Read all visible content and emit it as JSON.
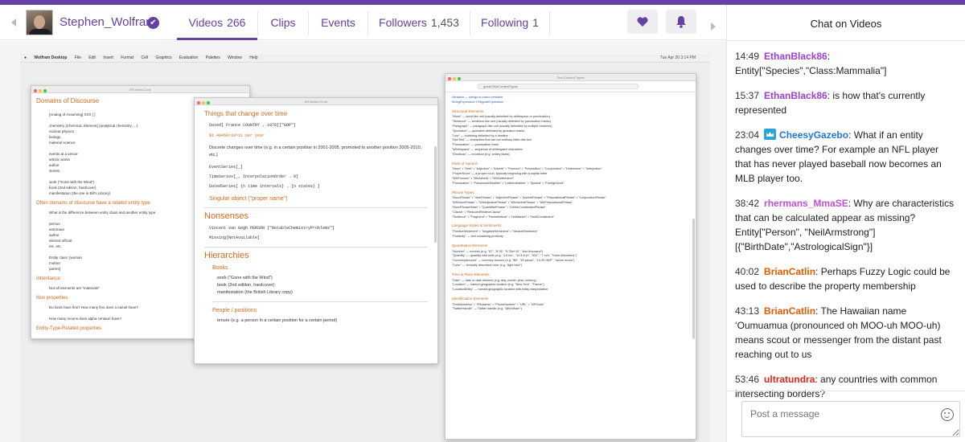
{
  "colors": {
    "brand": "#6441a4",
    "chat_user_purple": "#9b3fd6",
    "chat_user_orange": "#e05a00",
    "chat_user_red": "#e0251b",
    "chat_user_blue": "#2277d6"
  },
  "channel": {
    "name": "Stephen_Wolfram",
    "verified_icon": "check-circle-icon",
    "avatar_icon": "avatar"
  },
  "tabs": [
    {
      "label": "Videos",
      "count": "266",
      "active": true
    },
    {
      "label": "Clips",
      "count": ""
    },
    {
      "label": "Events",
      "count": ""
    },
    {
      "label": "Followers",
      "count": "1,453"
    },
    {
      "label": "Following",
      "count": "1"
    }
  ],
  "actions": {
    "follow_icon": "heart-icon",
    "notify_icon": "bell-icon"
  },
  "chat": {
    "title": "Chat on Videos",
    "input_placeholder": "Post a message",
    "messages": [
      {
        "time": "14:49",
        "user": "EthanBlack86",
        "color": "#9b3fd6",
        "text": "Entity[\"Species\",\"Class:Mammalia\"]",
        "badge": false
      },
      {
        "time": "15:37",
        "user": "EthanBlack86",
        "color": "#9b3fd6",
        "text": "is how that's currently represented",
        "badge": false
      },
      {
        "time": "23:04",
        "user": "CheesyGazebo",
        "color": "#2277d6",
        "text": "What if an entity changes over time? For example an NFL player that has never played baseball now becomes an MLB player too.",
        "badge": true
      },
      {
        "time": "38:42",
        "user": "rhermans_MmaSE",
        "color": "#c04fd8",
        "text": "Why are characteristics that can be calculated appear as missing? Entity[\"Person\", \"NeilArmstrong\"][{\"BirthDate\",\"AstrologicalSign\"}]",
        "badge": false
      },
      {
        "time": "40:02",
        "user": "BrianCatlin",
        "color": "#e05a00",
        "text": "Perhaps Fuzzy Logic could be used to describe the property membership",
        "badge": false
      },
      {
        "time": "43:13",
        "user": "BrianCatlin",
        "color": "#e05a00",
        "text": "The Hawaiian name ʻOumuamua (pronounced oh MOO-uh MOO-uh) means scout or messenger from the distant past reaching out to us",
        "badge": false
      },
      {
        "time": "53:46",
        "user": "ultratundra",
        "color": "#e0251b",
        "text": "any countries with common intersecting borders?",
        "badge": false
      }
    ]
  },
  "video": {
    "menubar": {
      "items": [
        "Wolfram Desktop",
        "File",
        "Edit",
        "Insert",
        "Format",
        "Cell",
        "Graphics",
        "Evaluation",
        "Palettes",
        "Window",
        "Help"
      ],
      "clock": "Tue Apr 30  3:14 PM"
    },
    "win1": {
      "title": "KR-Notes-1.nb",
      "heading": "Domains of Discourse",
      "lines": [
        "[Analog of Assuming] XXX [ ]",
        "chemistry [Chemical, Element] (analytical chemistry, ...)",
        "nuclear physics",
        "biology",
        "material science",
        "",
        "events at a venue",
        "artistic works",
        "author",
        "stories",
        "",
        "work (\"Gone with the Wind\")",
        "book (2nd edition, hardcover)",
        "manifestation (the one in Bill's Library)"
      ],
      "sub1": "Often domains of discourse have a related entity type",
      "lines2": [
        "What is the difference between entity class and another entity type",
        "",
        "person",
        "astronaut",
        "author",
        "elected official",
        "etc. etc.",
        "",
        "Entity class: [woman",
        "mother",
        "parent]"
      ],
      "sub2": "Inheritance:",
      "line3": "Not all elements are \"materials\"",
      "sub3": "Non properties",
      "lines4": [
        "Do birds have fins?  How many fins does a camel have?",
        "",
        "How many moons does alpha centauri have?"
      ],
      "sub4": "Entity-Type-Related properties"
    },
    "win2": {
      "title": "KR-Notes-03.nb",
      "h_things": "Things that change over time",
      "code1": "Dated[ France COUNTRY , 1970][\"GDP\"]",
      "out1": "$1.48458×10^11 per year",
      "para": "Discrete changes over time (e.g. in a certain position in 2001-2005, promoted to another position 2005-2010, etc.)",
      "code2": "EventSeries[_]",
      "code3": "TimeSeries[_, InterpolationOrder → 0]",
      "code4": "DatedSeries[ {n time intervals} → {n states} ]",
      "h_singular": "Singular object (\"proper name\")",
      "h_nonsenses": "Nonsenses",
      "code5": "Vincent van Gogh PERSON [\"NotableChemistryProblems\"]",
      "out5": "Missing[NotAvailable]",
      "h_hier": "Hierarchies",
      "h_books": "Books",
      "books": [
        "work (\"Gone with the Wind\")",
        "book    (2nd edition, hardcover)",
        "manifestation (the British Library copy)"
      ],
      "h_people": "People / positions",
      "people": "tenure (e.g. a person in a certain position for a certain period)"
    },
    "win3": {
      "title": "Text Content Types",
      "url": "guide/TextContentTypes",
      "top": [
        "Verbatim — strings to match verbatim",
        "StringExpression • RegularExpression"
      ],
      "sections": [
        {
          "h": "Structural Elements",
          "lines": [
            "\"Word\" — word-like unit (usually delimited by whitespace or punctuation)",
            "\"Sentence\" — sentence-like unit (usually delimited by punctuation marks)",
            "\"Paragraph\" — paragraph-like unit (usually delimited by multiple newlines)",
            "\"Quotation\" — quotation delimited by quotation marks",
            "\"Line\" — substring delimited by a newline",
            "\"NonText\" — characters that are not ordinary letter-like text",
            "\"Punctuation\" — punctuation mark",
            "\"Whitespace\" — sequence of whitespace characters",
            "\"Emoticon\" — emoticon (e.g. smiley faces)"
          ]
        },
        {
          "h": "Parts of Speech",
          "lines": [
            "\"Noun\" • \"Verb\" • \"Adjective\" • \"Adverb\" • \"Pronoun\" • \"Preposition\" • \"Conjunction\" • \"Determiner\" • \"Interjection\"",
            "\"ProperNoun\" — a proper noun, typically beginning with a capital letter",
            "\"WhPronoun\" • \"WhAdverb\" • \"WhDeterminer\"",
            "\"Punctuation\" • \"PossessiveModifier\" • \"ListItemMarker\" • \"Symbol\" • \"ForeignWord\""
          ]
        },
        {
          "h": "Phrase Types",
          "lines": [
            "\"NounPhrase\" • \"VerbPhrase\" • \"AdjectivePhrase\" • \"AdverbPhrase\" • \"PrepositionalPhrase\" • \"ConjunctionPhrase\"",
            "\"WhNounPhrase\" • \"WhAdjectivePhrase\" • \"WhAdverbPhrase\" • \"WhPrepositionalPhrase\"",
            "\"NounPhraseHead\" • \"QuantifierPhrase\" • \"UnlikeCoordinatedPhrase\"",
            "\"Clause\" • \"ReducedRelativeClause\"",
            "\"Sentence\" • \"Fragment\" • \"Parenthetical\" • \"ListMarker\" • \"NotAConstituent\""
          ]
        },
        {
          "h": "Language Styles & Sentiments",
          "lines": [
            "\"PositiveSentiment\" • \"NegativeSentiment\" • \"NeutralSentiment\"",
            "\"Profanity\" — text containing profanity"
          ]
        },
        {
          "h": "Quantitative Elements",
          "lines": [
            "\"Number\" — number (e.g. \"67\", \"6.78\", \"6.78e+10\", \"two thousand\")",
            "\"Quantity\" — quantity with units (e.g. \"4.5 km\", \"10 ft 6 in\", \"30C\", \"7 m/s\", \"three kilometers\")",
            "\"CurrencyAmount\" — currency amount (e.g. \"$5\", \"45 pesos\", \"10.25 GBP\", \"seven euros\")",
            "\"Color\" — textually described color (e.g. \"light blue\")"
          ]
        },
        {
          "h": "Time & Place Elements",
          "lines": [
            "\"Date\" — date or date element (e.g. day, month, year, century)",
            "\"Location\" — named geographic location (e.g. \"New York\", \"France\")",
            "\"LocationEntity\" — named geographic location with entity interpretation"
          ]
        },
        {
          "h": "Identification Elements",
          "lines": [
            "\"EmailAddress\" • \"IPAddress\" • \"PhoneNumber\" • \"URL\" • \"ZIPCode\"",
            "\"TwitterHandle\" — Twitter handle (e.g. \"@Wolfram\")"
          ]
        }
      ]
    }
  }
}
